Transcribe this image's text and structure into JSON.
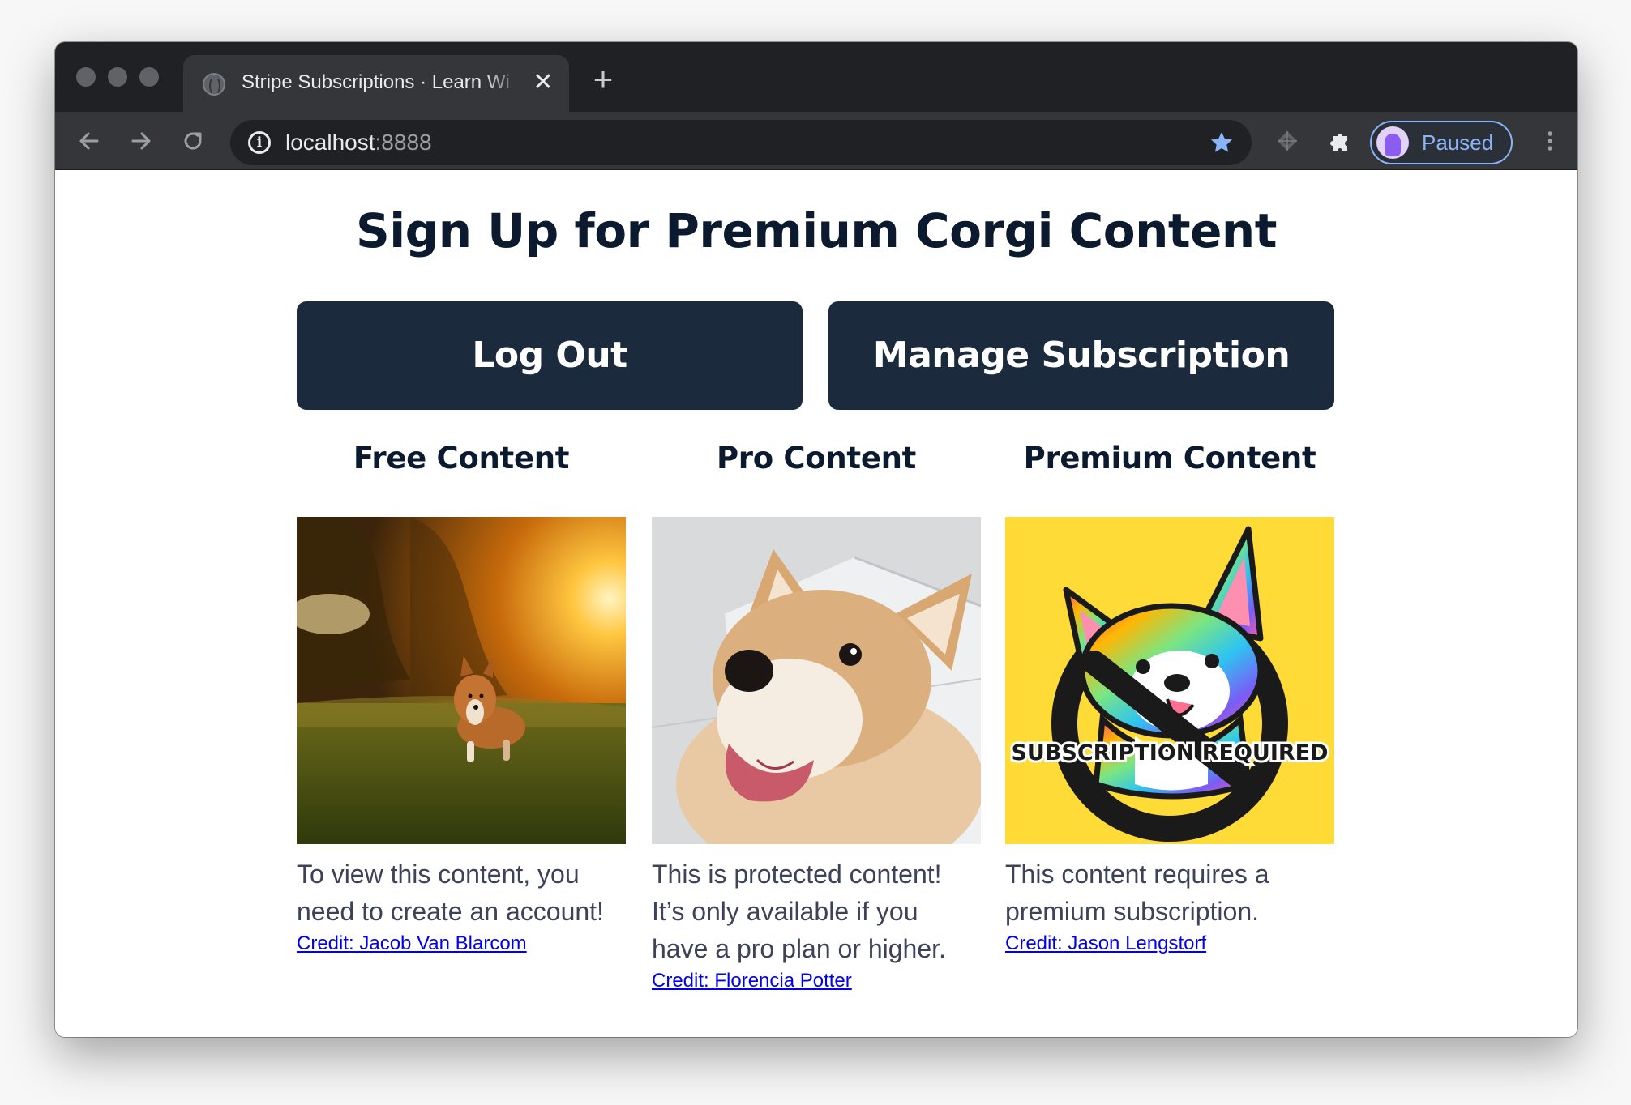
{
  "browser": {
    "tab_title": "Stripe Subscriptions · Learn Wi",
    "tab_close_glyph": "✕",
    "new_tab_glyph": "+",
    "url_host": "localhost",
    "url_port": ":8888",
    "profile_label": "Paused",
    "accent_color": "#8ab4f8"
  },
  "page": {
    "title": "Sign Up for Premium Corgi Content",
    "buttons": {
      "logout_label": "Log Out",
      "manage_label": "Manage Subscription"
    },
    "columns": [
      {
        "heading": "Free Content",
        "description": "To view this content, you need to create an account!",
        "credit": "Credit: Jacob Van Blarcom",
        "image": "corgi-running-in-sunset-field"
      },
      {
        "heading": "Pro Content",
        "description": "This is protected content! It’s only available if you have a pro plan or higher.",
        "credit": "Credit: Florencia Potter",
        "image": "corgi-smiling-closeup"
      },
      {
        "heading": "Premium Content",
        "description": "This content requires a premium subscription.",
        "credit": "Credit: Jason Lengstorf",
        "image": "rainbow-corgi-subscription-required",
        "image_text": "SUBSCRIPTION REQUIRED"
      }
    ],
    "colors": {
      "button_bg": "#1c2a3e",
      "heading_text": "#0b1a2e",
      "link": "#0000ee",
      "premium_bg": "#fedb37"
    }
  }
}
